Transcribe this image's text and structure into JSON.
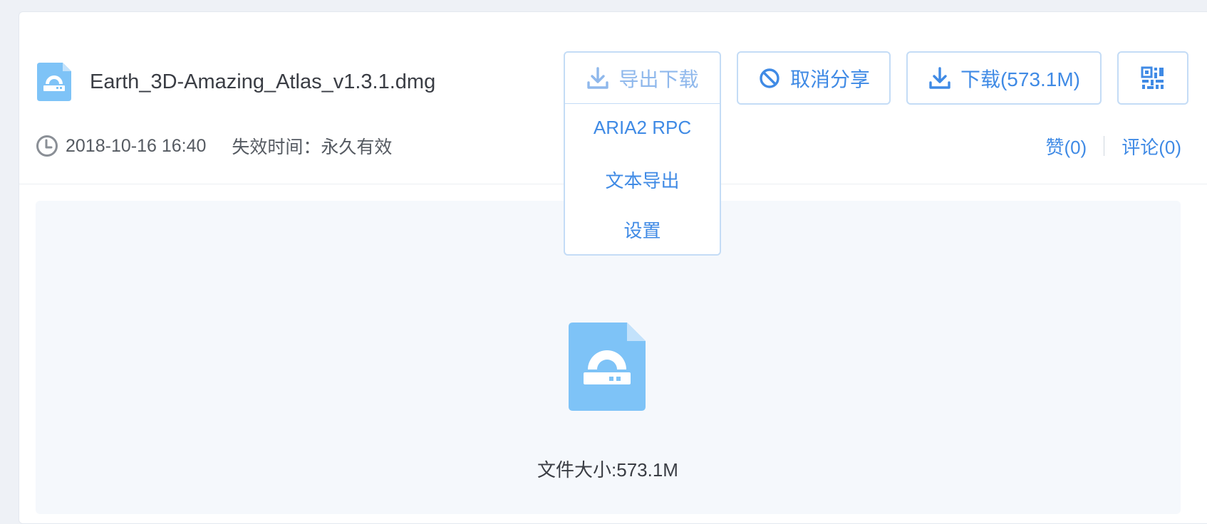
{
  "file": {
    "name": "Earth_3D-Amazing_Atlas_v1.3.1.dmg",
    "icon": "dmg-file-icon",
    "size_text": "文件大小:573.1M"
  },
  "meta": {
    "created": "2018-10-16 16:40",
    "expire_label": "失效时间：永久有效"
  },
  "social": {
    "like_label": "赞(0)",
    "comment_label": "评论(0)"
  },
  "toolbar": {
    "export_label": "导出下载",
    "cancel_share_label": "取消分享",
    "download_label": "下载(573.1M)"
  },
  "export_menu": {
    "items": [
      "ARIA2 RPC",
      "文本导出",
      "设置"
    ]
  },
  "colors": {
    "accent": "#3f8ae5",
    "accent_muted": "#8fb8ec",
    "button_border": "#c4dcf6",
    "file_icon": "#7ec3f7",
    "page_bg": "#eef1f6",
    "preview_bg": "#f5f8fc"
  }
}
